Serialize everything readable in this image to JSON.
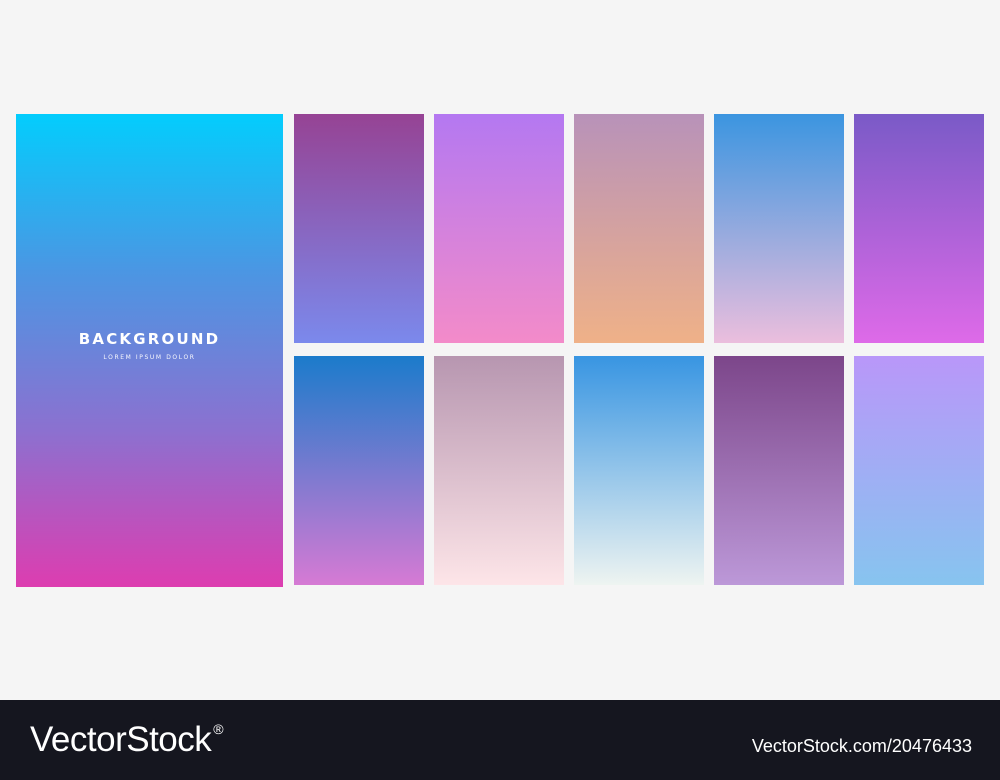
{
  "hero": {
    "title": "BACKGROUND",
    "subtitle": "LOREM IPSUM DOLOR",
    "gradient": [
      "#03cdfd",
      "#4b96e3",
      "#8b71d0",
      "#dd3db0"
    ]
  },
  "swatches": [
    {
      "name": "swatch-plum-to-periwinkle",
      "colors": [
        "#964394",
        "#7b89ec"
      ]
    },
    {
      "name": "swatch-lavender-to-pink",
      "colors": [
        "#b478f1",
        "#f38bc9"
      ]
    },
    {
      "name": "swatch-mauve-to-peach",
      "colors": [
        "#b892b9",
        "#efb188"
      ]
    },
    {
      "name": "swatch-sky-to-blush",
      "colors": [
        "#3b95e0",
        "#ebbedd"
      ]
    },
    {
      "name": "swatch-indigo-to-magenta",
      "colors": [
        "#7a5ac7",
        "#de6ae8"
      ]
    },
    {
      "name": "swatch-blue-to-orchid",
      "colors": [
        "#1b7bcb",
        "#d67ad4"
      ]
    },
    {
      "name": "swatch-dusty-mauve-to-pale-pink",
      "colors": [
        "#b796b0",
        "#fde5e8"
      ]
    },
    {
      "name": "swatch-blue-to-mist",
      "colors": [
        "#3895e2",
        "#eef4f1"
      ]
    },
    {
      "name": "swatch-purple-to-lilac",
      "colors": [
        "#7c468a",
        "#bc98d8"
      ]
    },
    {
      "name": "swatch-violet-to-light-blue",
      "colors": [
        "#b997f9",
        "#87c4ef"
      ]
    }
  ],
  "footer": {
    "brand": "VectorStock",
    "registered_mark": "®",
    "reference": "VectorStock.com/20476433",
    "background": "#15161f"
  }
}
